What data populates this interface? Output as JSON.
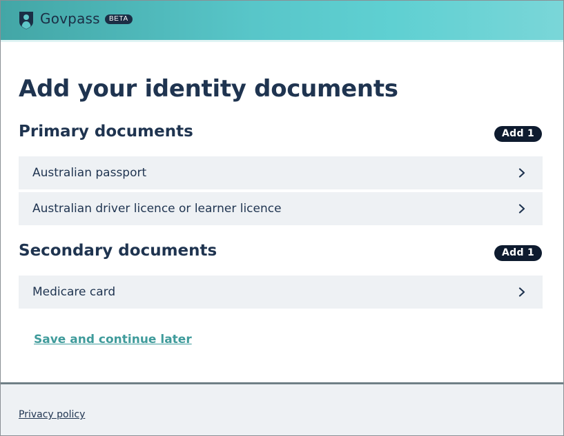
{
  "header": {
    "logo_icon": "shield-person-icon",
    "brand_name": "Govpass",
    "beta_badge": "BETA"
  },
  "main": {
    "title": "Add your identity documents",
    "sections": [
      {
        "heading": "Primary documents",
        "badge": "Add 1",
        "items": [
          {
            "label": "Australian passport",
            "icon": "chevron-right-icon"
          },
          {
            "label": "Australian driver licence or learner licence",
            "icon": "chevron-right-icon"
          }
        ]
      },
      {
        "heading": "Secondary documents",
        "badge": "Add 1",
        "items": [
          {
            "label": "Medicare card",
            "icon": "chevron-right-icon"
          }
        ]
      }
    ],
    "save_link": "Save and continue later"
  },
  "footer": {
    "privacy_link": "Privacy policy"
  },
  "colors": {
    "header_gradient_start": "#43a6a6",
    "header_gradient_end": "#7ad6d8",
    "text_primary": "#1f3450",
    "badge_bg": "#0e1b2f",
    "row_bg": "#eef1f4",
    "link_teal": "#3f9b9b"
  }
}
